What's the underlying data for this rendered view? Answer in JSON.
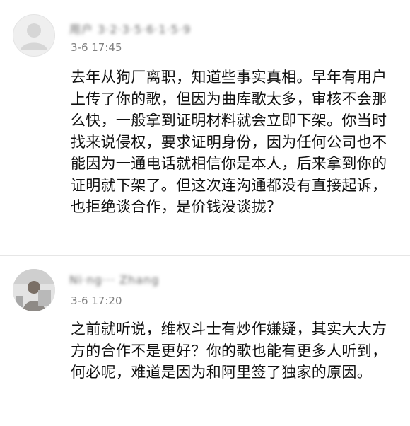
{
  "comments": [
    {
      "username": "用户 3·2·3·5·6·1·5·9",
      "timestamp": "3-6 17:45",
      "text": "去年从狗厂离职，知道些事实真相。早年有用户上传了你的歌，但因为曲库歌太多，审核不会那么快，一般拿到证明材料就会立即下架。你当时找来说侵权，要求证明身份，因为任何公司也不能因为一通电话就相信你是本人，后来拿到你的证明就下架了。但这次连沟通都没有直接起诉，也拒绝谈合作，是价钱没谈拢？"
    },
    {
      "username": "Ni·ng··· Zhang",
      "timestamp": "3-6 17:20",
      "text": "之前就听说，维权斗士有炒作嫌疑，其实大大方方的合作不是更好？你的歌也能有更多人听到，何必呢，难道是因为和阿里签了独家的原因。"
    }
  ],
  "colors": {
    "text": "#111111",
    "timestamp": "#808080",
    "divider": "#e6e6e6"
  },
  "icons": {
    "default_avatar": "user-silhouette-icon",
    "photo_avatar": "photo-avatar"
  }
}
